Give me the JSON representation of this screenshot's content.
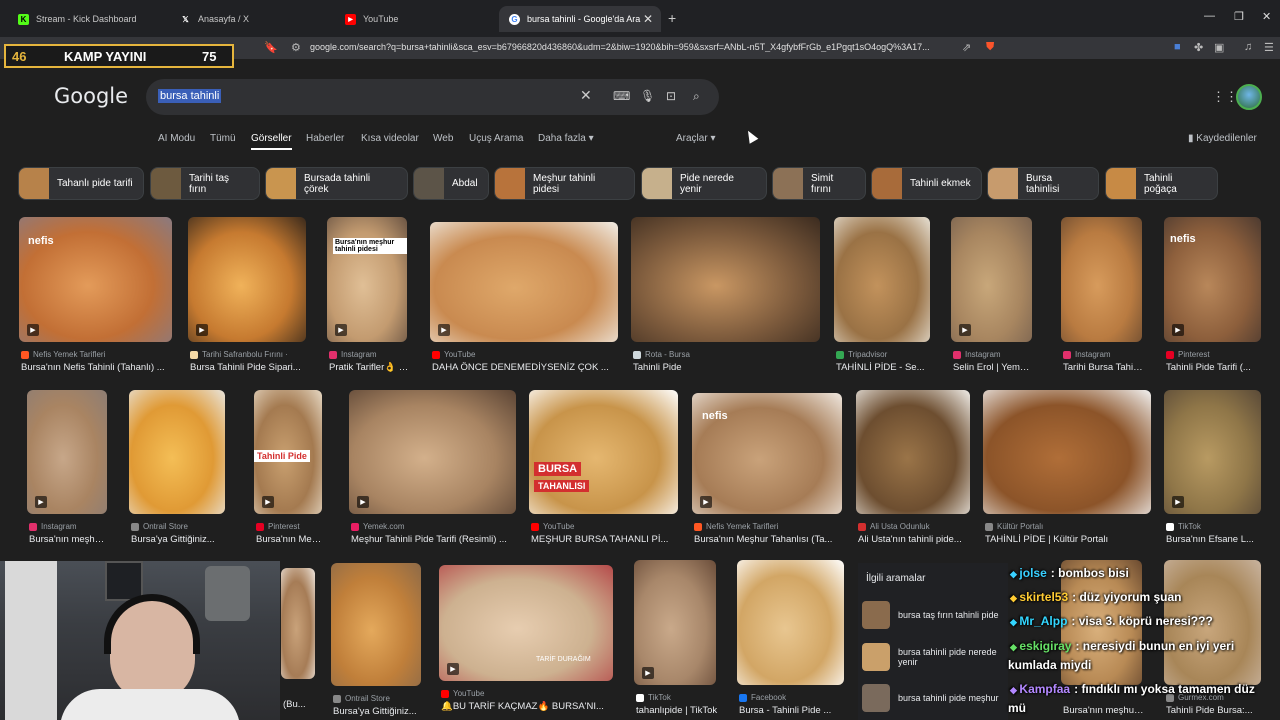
{
  "browser": {
    "tabs": [
      {
        "label": "Stream - Kick Dashboard",
        "icon": "kick-icon",
        "color": "#53fc18"
      },
      {
        "label": "Anasayfa / X",
        "icon": "x-icon",
        "color": "#ffffff"
      },
      {
        "label": "YouTube",
        "icon": "youtube-icon",
        "color": "#ff0000"
      },
      {
        "label": "bursa tahinli - Google'da Ara",
        "icon": "google-icon",
        "color": "#4285f4"
      }
    ],
    "new_tab": "+",
    "url": "google.com/search?q=bursa+tahinli&sca_esv=b67966820d436860&udm=2&biw=1920&bih=959&sxsrf=ANbL-n5T_X4gfybfFrGb_e1Pgqt1sO4ogQ%3A17..."
  },
  "overlay": {
    "left_num": "46",
    "title": "KAMP YAYINI",
    "right_num": "75"
  },
  "google": {
    "logo": "Google",
    "query": "bursa tahinli",
    "nav": [
      "AI Modu",
      "Tümü",
      "Görseller",
      "Haberler",
      "Kısa videolar",
      "Web",
      "Uçuş Arama",
      "Daha fazla ▾"
    ],
    "tools": "Araçlar ▾",
    "saved": "Kaydedilenler"
  },
  "chips": [
    "Tahanlı pide tarifi",
    "Tarihi taş fırın",
    "Bursada tahinli çörek",
    "Abdal",
    "Meşhur tahinli pidesi",
    "Pide nerede yenir",
    "Simit fırını",
    "Tahinli ekmek",
    "Bursa tahinlisi",
    "Tahinli poğaça"
  ],
  "row1": [
    {
      "source": "Nefis Yemek Tarifleri",
      "title": "Bursa'nın Nefis Tahinli (Tahanlı) ..."
    },
    {
      "source": "Tarihi Safranbolu Fırını ·",
      "title": "Bursa Tahinli Pide Sipari..."
    },
    {
      "source": "Instagram",
      "title": "Pratik Tarifler👌 | B..."
    },
    {
      "source": "YouTube",
      "title": "DAHA ÖNCE DENEMEDİYSENİZ ÇOK ..."
    },
    {
      "source": "Rota - Bursa",
      "title": "Tahinli Pide"
    },
    {
      "source": "Tripadvisor",
      "title": "TAHİNLİ PİDE - Se..."
    },
    {
      "source": "Instagram",
      "title": "Selin Erol | Yemek ..."
    },
    {
      "source": "Instagram",
      "title": "Tarihi Bursa Tahinli..."
    },
    {
      "source": "Pinterest",
      "title": "Tahinli Pide Tarifi (..."
    }
  ],
  "row2": [
    {
      "source": "Instagram",
      "title": "Bursa'nın meşhur t..."
    },
    {
      "source": "Ontrail Store",
      "title": "Bursa'ya Gittiğiniz..."
    },
    {
      "source": "Pinterest",
      "title": "Bursa'nın Meşhur ..."
    },
    {
      "source": "Yemek.com",
      "title": "Meşhur Tahinli Pide Tarifi (Resimli) ..."
    },
    {
      "source": "YouTube",
      "title": "MEŞHUR BURSA TAHANLI Pİ..."
    },
    {
      "source": "Nefis Yemek Tarifleri",
      "title": "Bursa'nın Meşhur Tahanlısı (Ta..."
    },
    {
      "source": "Ali Usta Odunluk",
      "title": "Ali Usta'nın tahinli pide..."
    },
    {
      "source": "Kültür Portalı",
      "title": "TAHİNLİ PİDE | Kültür Portalı"
    },
    {
      "source": "TikTok",
      "title": "Bursa'nın Efsane L..."
    }
  ],
  "row3": [
    {
      "source": "",
      "title": "(Bu..."
    },
    {
      "source": "Ontrail Store",
      "title": "Bursa'ya Gittiğiniz..."
    },
    {
      "source": "YouTube",
      "title": "🔔BU TARİF KAÇMAZ🔥 BURSA'NI..."
    },
    {
      "source": "TikTok",
      "title": "tahanlıpide | TikTok"
    },
    {
      "source": "Facebook",
      "title": "Bursa - Tahinli Pide ..."
    },
    {
      "source": "",
      "title": "Bursa'nın meşhur t..."
    },
    {
      "source": "Gurmex.com",
      "title": "Tahinli Pide Bursa:..."
    }
  ],
  "img_texts": {
    "bursa_meshur": "Bursa'nın meşhur tahinli pidesi",
    "tahinli_pide": "Tahinli Pide",
    "bursa": "BURSA",
    "tahanlisi": "TAHANLISI",
    "nefis": "nefis",
    "tarif": "TARİF DURAĞIM"
  },
  "related": {
    "header": "İlgili aramalar",
    "items": [
      "bursa taş fırın tahinli pide",
      "bursa tahinli pide nerede yenir",
      "bursa tahinli pide meşhur"
    ]
  },
  "chat": [
    {
      "user": "jolse",
      "msg": ": bombos bisi",
      "color": "#39d0ff"
    },
    {
      "user": "skirtel53",
      "msg": ": düz yiyorum şuan",
      "color": "#ffcc33"
    },
    {
      "user": "Mr_Alpp",
      "msg": ": visa 3. köprü neresi???",
      "color": "#33d6ff"
    },
    {
      "user": "eskigiray",
      "msg": ": neresiydi bunun en iyi yeri",
      "color": "#66e066"
    },
    {
      "user": "",
      "msg": "kumlada miydi",
      "color": "#ffffff"
    },
    {
      "user": "Kampfaa",
      "msg": ": fındıklı mı yoksa tamamen düz",
      "color": "#b388ff"
    },
    {
      "user": "",
      "msg": "mü",
      "color": "#ffffff"
    }
  ]
}
